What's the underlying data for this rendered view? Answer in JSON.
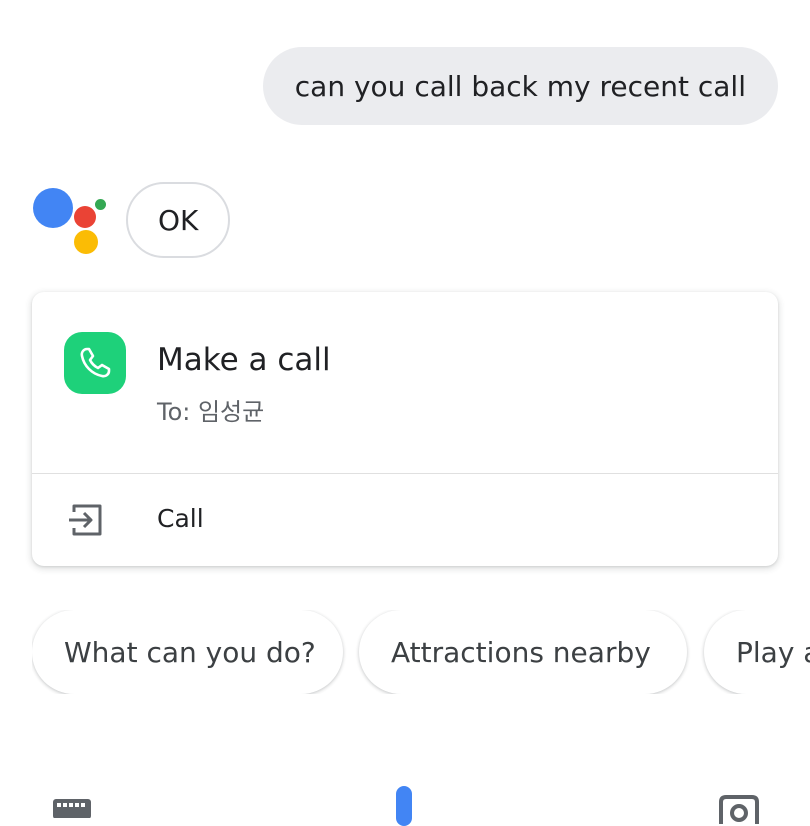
{
  "conversation": {
    "user_query": "can you call back my recent call",
    "assistant_reply": "OK"
  },
  "assistant_logo": {
    "colors": {
      "blue": "#4285f4",
      "red": "#ea4335",
      "yellow": "#fbbc05",
      "green": "#34a853"
    }
  },
  "call_card": {
    "app_icon": "phone-icon",
    "app_icon_color": "#1ed17a",
    "title": "Make a call",
    "subtitle": "To: 임성균",
    "action": {
      "icon": "exit-to-app-icon",
      "label": "Call"
    }
  },
  "suggestions": [
    {
      "label": "What can you do?"
    },
    {
      "label": "Attractions nearby"
    },
    {
      "label": "Play a"
    }
  ],
  "bottom_bar": {
    "left_icon": "keyboard-icon",
    "center_icon": "mic-icon",
    "right_icon": "lens-icon",
    "mic_color": "#4285f4"
  }
}
